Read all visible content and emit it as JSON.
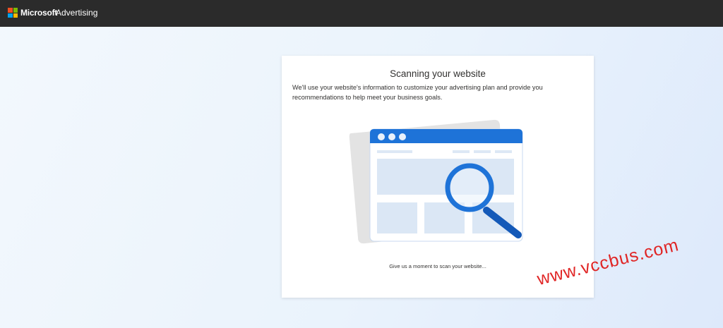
{
  "header": {
    "brand": "Microsoft",
    "product": "Advertising"
  },
  "card": {
    "title": "Scanning your website",
    "description": "We'll use your website's information to customize your advertising plan and provide you recommendations to help meet your business goals.",
    "status": "Give us a moment to scan your website..."
  },
  "watermark": "www.vccbus.com",
  "icons": [
    "microsoft-logo-icon",
    "website-scan-illustration",
    "magnifier-icon"
  ],
  "colors": {
    "topbar": "#2b2b2b",
    "accent_blue": "#1e73d8",
    "watermark_red": "#e02424"
  }
}
